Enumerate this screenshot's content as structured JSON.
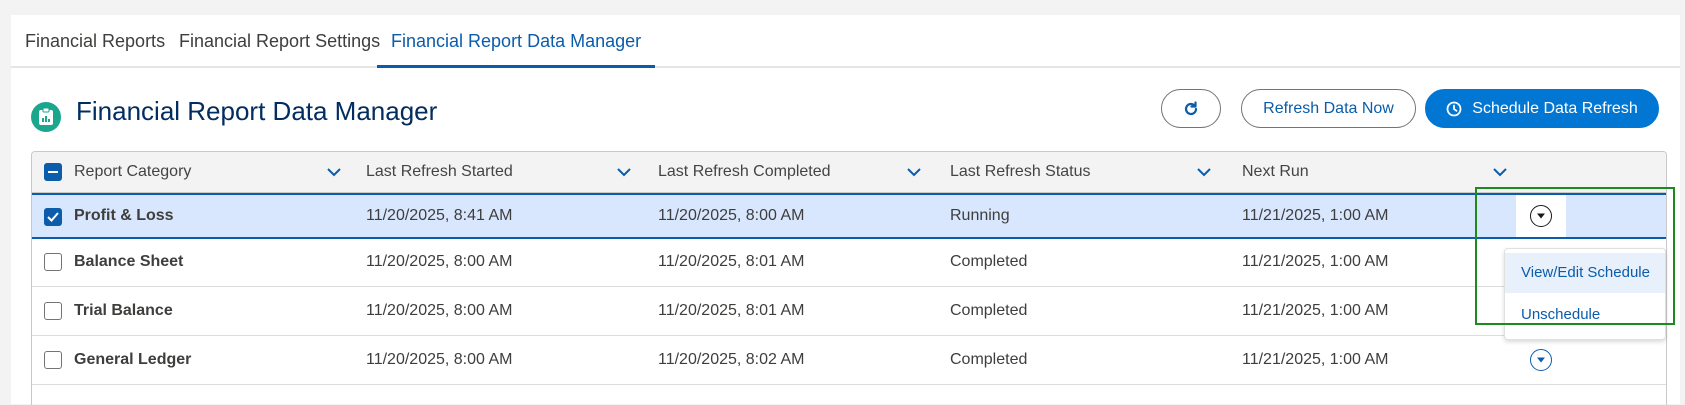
{
  "tabs": [
    {
      "label": "Financial Reports"
    },
    {
      "label": "Financial Report Settings"
    },
    {
      "label": "Financial Report Data Manager"
    }
  ],
  "header": {
    "title": "Financial Report Data Manager",
    "icon": "report-icon",
    "refresh_icon": "refresh-icon",
    "refresh_now_label": "Refresh Data Now",
    "schedule_label": "Schedule Data Refresh",
    "schedule_icon": "clock-icon"
  },
  "table": {
    "columns": [
      "Report Category",
      "Last Refresh Started",
      "Last Refresh Completed",
      "Last Refresh Status",
      "Next Run"
    ],
    "rows": [
      {
        "category": "Profit & Loss",
        "started": "11/20/2025, 8:41 AM",
        "completed": "11/20/2025, 8:00 AM",
        "status": "Running",
        "next_run": "11/21/2025, 1:00 AM",
        "checked": true
      },
      {
        "category": "Balance Sheet",
        "started": "11/20/2025, 8:00 AM",
        "completed": "11/20/2025, 8:01 AM",
        "status": "Completed",
        "next_run": "11/21/2025, 1:00 AM",
        "checked": false
      },
      {
        "category": "Trial Balance",
        "started": "11/20/2025, 8:00 AM",
        "completed": "11/20/2025, 8:01 AM",
        "status": "Completed",
        "next_run": "11/21/2025, 1:00 AM",
        "checked": false
      },
      {
        "category": "General Ledger",
        "started": "11/20/2025, 8:00 AM",
        "completed": "11/20/2025, 8:02 AM",
        "status": "Completed",
        "next_run": "11/21/2025, 1:00 AM",
        "checked": false
      }
    ]
  },
  "row_menu": {
    "items": [
      "View/Edit Schedule",
      "Unschedule"
    ]
  },
  "colors": {
    "brand": "#0176d3",
    "link": "#0b5cab",
    "icon_bg": "#1ba68e",
    "selected_row": "#d8e6fe",
    "highlight": "#1e8a1e"
  }
}
